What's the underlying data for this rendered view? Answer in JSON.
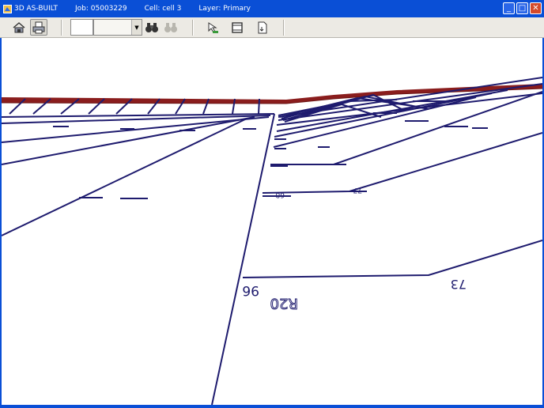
{
  "window": {
    "title": "3D AS-BUILT",
    "job": "Job: 05003229",
    "cell": "Cell: cell 3",
    "layer": "Layer: Primary",
    "minimize_glyph": "_",
    "maximize_glyph": "□",
    "close_glyph": "✕"
  },
  "toolbar": {
    "combo_value": "",
    "combo_arrow": "▼"
  },
  "viewport": {
    "line_color": "#1e1b6e",
    "rail_color": "#8a1d1d",
    "labels": {
      "lot_96": "96",
      "lot_r20": "R20",
      "lot_73": "73",
      "lot_small_1": "68",
      "lot_small_2": "77"
    }
  }
}
